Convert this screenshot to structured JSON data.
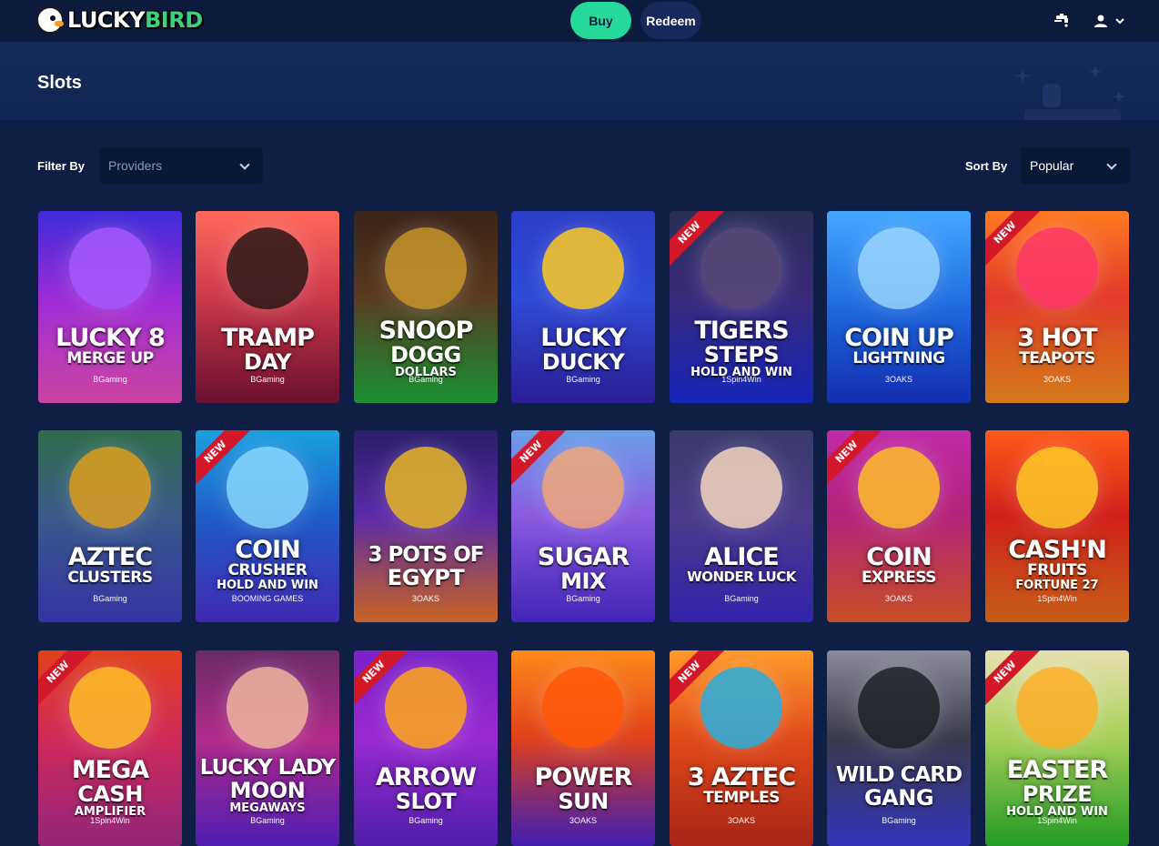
{
  "header": {
    "logo_text_1": "LUCKY",
    "logo_text_2": "BIRD",
    "buy_label": "Buy",
    "redeem_label": "Redeem",
    "icons": [
      "faucet-icon",
      "user-icon",
      "chevron-down-icon"
    ]
  },
  "page": {
    "title": "Slots"
  },
  "filters": {
    "filter_label": "Filter By",
    "providers_placeholder": "Providers",
    "sort_label": "Sort By",
    "sort_value": "Popular"
  },
  "colors": {
    "background": "#0e1e44",
    "header": "#0b1a3d",
    "buy_button": "#25d99b",
    "redeem_button": "#16295a",
    "new_ribbon": "#d3182a"
  },
  "games": [
    {
      "line1": "LUCKY 8",
      "line2": "MERGE UP",
      "line3": "",
      "provider": "BGaming",
      "is_new": false
    },
    {
      "line1": "TRAMP",
      "line2": "DAY",
      "line3": "",
      "provider": "BGaming",
      "is_new": false
    },
    {
      "line1": "SNOOP",
      "line2": "DOGG",
      "line3": "DOLLARS",
      "provider": "BGaming",
      "is_new": false
    },
    {
      "line1": "LUCKY",
      "line2": "DUCKY",
      "line3": "",
      "provider": "BGaming",
      "is_new": false
    },
    {
      "line1": "TIGERS",
      "line2": "STEPS",
      "line3": "HOLD AND WIN",
      "provider": "1Spin4Win",
      "is_new": true
    },
    {
      "line1": "COIN UP",
      "line2": "LIGHTNING",
      "line3": "",
      "provider": "3OAKS",
      "is_new": false
    },
    {
      "line1": "3 HOT",
      "line2": "TEAPOTS",
      "line3": "",
      "provider": "3OAKS",
      "is_new": true
    },
    {
      "line1": "AZTEC",
      "line2": "CLUSTERS",
      "line3": "",
      "provider": "BGaming",
      "is_new": false
    },
    {
      "line1": "COIN",
      "line2": "CRUSHER",
      "line3": "HOLD AND WIN",
      "provider": "BOOMING GAMES",
      "is_new": true
    },
    {
      "line1": "3 POTS OF",
      "line2": "EGYPT",
      "line3": "",
      "provider": "3OAKS",
      "is_new": false
    },
    {
      "line1": "SUGAR",
      "line2": "MIX",
      "line3": "",
      "provider": "BGaming",
      "is_new": true
    },
    {
      "line1": "ALICE",
      "line2": "WONDER LUCK",
      "line3": "",
      "provider": "BGaming",
      "is_new": false
    },
    {
      "line1": "COIN",
      "line2": "EXPRESS",
      "line3": "",
      "provider": "3OAKS",
      "is_new": true
    },
    {
      "line1": "CASH'N",
      "line2": "FRUITS",
      "line3": "FORTUNE 27",
      "provider": "1Spin4Win",
      "is_new": false
    },
    {
      "line1": "MEGA",
      "line2": "CASH",
      "line3": "AMPLIFIER",
      "provider": "1Spin4Win",
      "is_new": true
    },
    {
      "line1": "LUCKY LADY",
      "line2": "MOON",
      "line3": "MEGAWAYS",
      "provider": "BGaming",
      "is_new": false
    },
    {
      "line1": "ARROW",
      "line2": "SLOT",
      "line3": "",
      "provider": "BGaming",
      "is_new": true
    },
    {
      "line1": "POWER",
      "line2": "SUN",
      "line3": "",
      "provider": "3OAKS",
      "is_new": false
    },
    {
      "line1": "3 AZTEC",
      "line2": "TEMPLES",
      "line3": "",
      "provider": "3OAKS",
      "is_new": true
    },
    {
      "line1": "WILD CARD",
      "line2": "GANG",
      "line3": "",
      "provider": "BGaming",
      "is_new": false
    },
    {
      "line1": "EASTER",
      "line2": "PRIZE",
      "line3": "HOLD AND WIN",
      "provider": "1Spin4Win",
      "is_new": true
    }
  ]
}
